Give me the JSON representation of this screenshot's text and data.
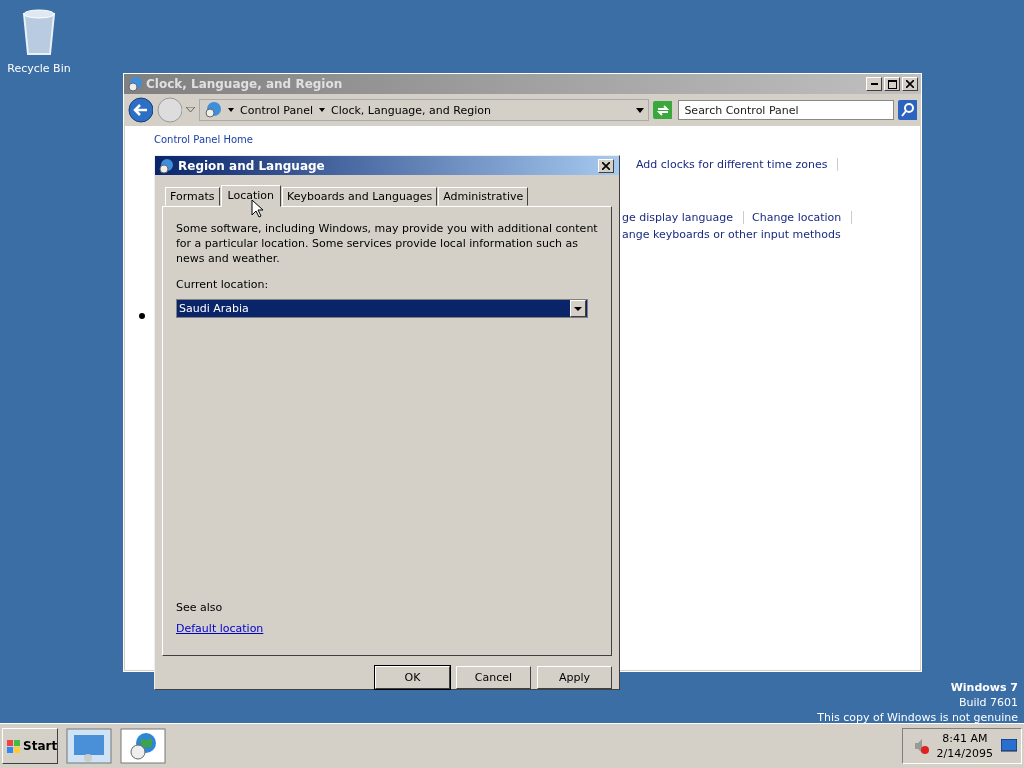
{
  "desktop_icons": [
    {
      "label": "Recycle Bin"
    }
  ],
  "explorer": {
    "title": "Clock, Language, and Region",
    "breadcrumb": [
      "Control Panel",
      "Clock, Language, and Region"
    ],
    "search": {
      "placeholder": "Search Control Panel"
    },
    "sidebar_link": "Control Panel Home",
    "link_rows": [
      [
        "Add clocks for different time zones"
      ],
      [
        "ge display language",
        "Change location"
      ],
      [
        "ange keyboards or other input methods"
      ]
    ]
  },
  "dialog": {
    "title": "Region and Language",
    "tabs": [
      {
        "label": "Formats",
        "selected": false
      },
      {
        "label": "Location",
        "selected": true
      },
      {
        "label": "Keyboards and Languages",
        "selected": false
      },
      {
        "label": "Administrative",
        "selected": false
      }
    ],
    "description": "Some software, including Windows, may provide you with additional content for a particular location. Some services provide local information such as news and weather.",
    "location_label": "Current location:",
    "location_value": "Saudi Arabia",
    "see_also": "See also",
    "default_location_link": "Default location",
    "buttons": [
      "OK",
      "Cancel",
      "Apply"
    ]
  },
  "watermark": [
    "Windows 7",
    "Build 7601",
    "This copy of Windows is not genuine"
  ],
  "taskbar": {
    "start": "Start",
    "time": "8:41 AM",
    "date": "2/14/2095"
  }
}
